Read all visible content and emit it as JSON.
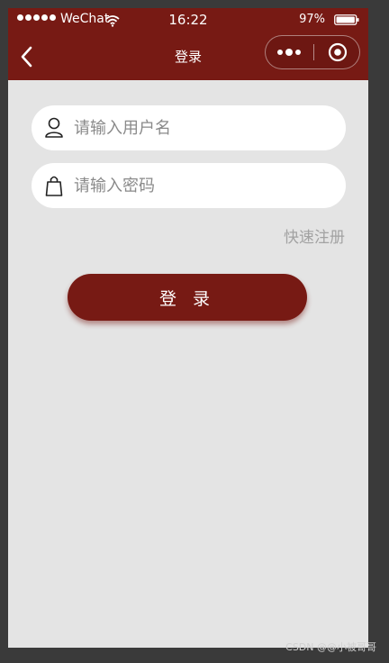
{
  "status_bar": {
    "carrier": "WeChat",
    "time": "16:22",
    "battery": "97%",
    "battery_level": 0.97
  },
  "nav": {
    "title": "登录"
  },
  "form": {
    "username": {
      "placeholder": "请输入用户名",
      "value": ""
    },
    "password": {
      "placeholder": "请输入密码",
      "value": ""
    },
    "register_link": "快速注册",
    "login_button": "登 录"
  },
  "watermark": "CSDN @@小被哥哥",
  "colors": {
    "brand": "#771a14",
    "background": "#e4e4e4",
    "input_bg": "#ffffff",
    "link": "#a2a2a2"
  },
  "icons": {
    "back": "chevron-left-icon",
    "more": "more-dots-icon",
    "close": "capsule-close-icon",
    "user": "user-icon",
    "lock": "bag-icon"
  }
}
